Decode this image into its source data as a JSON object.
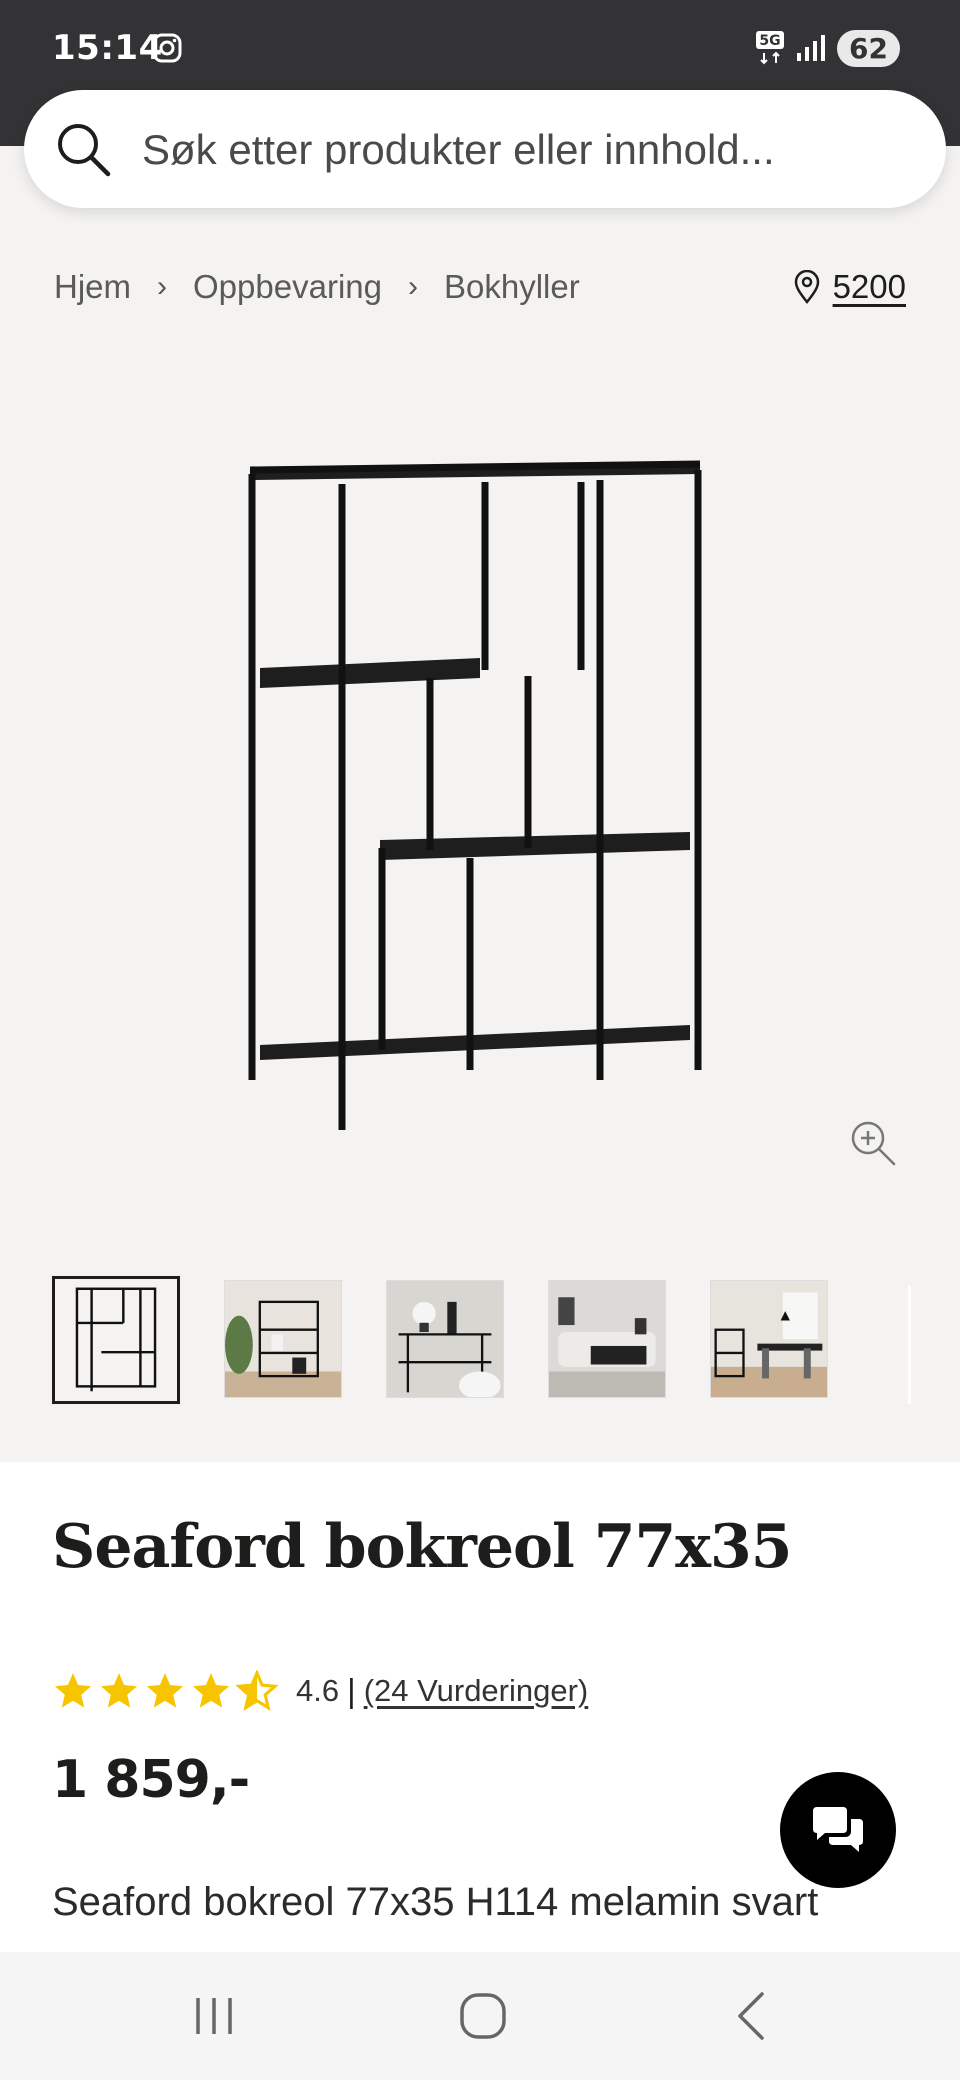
{
  "status_bar": {
    "time": "15:14",
    "network": "5G",
    "battery": "62"
  },
  "search": {
    "placeholder": "Søk etter produkter eller innhold..."
  },
  "breadcrumb": {
    "items": [
      "Hjem",
      "Oppbevaring",
      "Bokhyller"
    ]
  },
  "location": {
    "code": "5200"
  },
  "gallery": {
    "thumbnail_count": 5,
    "active_index": 0
  },
  "product": {
    "title": "Seaford bokreol 77x35",
    "rating": {
      "value": "4.6",
      "stars": 4.6,
      "max": 5,
      "separator": "|",
      "reviews": "(24 Vurderinger)"
    },
    "price": "1 859,-",
    "description": "Seaford bokreol 77x35 H114 melamin svart"
  },
  "colors": {
    "status_bar": "#333335",
    "page_bg": "#f4f3f1",
    "star": "#f7c500",
    "text": "#1d1d1b",
    "chat_button": "#000000"
  },
  "icons": {
    "status": [
      "instagram-icon",
      "5g-icon",
      "signal-icon"
    ],
    "search": "search-icon",
    "location": "location-pin-icon",
    "zoom": "zoom-in-icon",
    "chat": "chat-icon",
    "nav": [
      "recent-apps-icon",
      "home-icon",
      "back-icon"
    ]
  }
}
